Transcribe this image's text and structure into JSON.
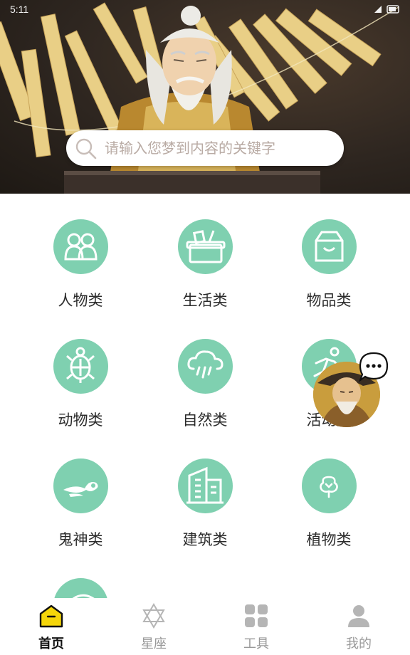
{
  "status_bar": {
    "time": "5:11"
  },
  "search": {
    "placeholder": "请输入您梦到内容的关键字",
    "value": ""
  },
  "categories": [
    {
      "label": "人物类",
      "icon": "people-icon"
    },
    {
      "label": "生活类",
      "icon": "basket-icon"
    },
    {
      "label": "物品类",
      "icon": "bag-icon"
    },
    {
      "label": "动物类",
      "icon": "turtle-icon"
    },
    {
      "label": "自然类",
      "icon": "rain-cloud-icon"
    },
    {
      "label": "活动类",
      "icon": "running-icon"
    },
    {
      "label": "鬼神类",
      "icon": "cloud-spirit-icon"
    },
    {
      "label": "建筑类",
      "icon": "building-icon"
    },
    {
      "label": "植物类",
      "icon": "tree-icon"
    }
  ],
  "bottom_nav": {
    "items": [
      {
        "label": "首页",
        "icon": "home-icon",
        "active": true
      },
      {
        "label": "星座",
        "icon": "star-of-david-icon",
        "active": false
      },
      {
        "label": "工具",
        "icon": "grid-icon",
        "active": false
      },
      {
        "label": "我的",
        "icon": "user-icon",
        "active": false
      }
    ]
  },
  "colors": {
    "accent_green": "#7fd0b0",
    "home_active": "#f5d60a",
    "nav_inactive": "#999999"
  }
}
